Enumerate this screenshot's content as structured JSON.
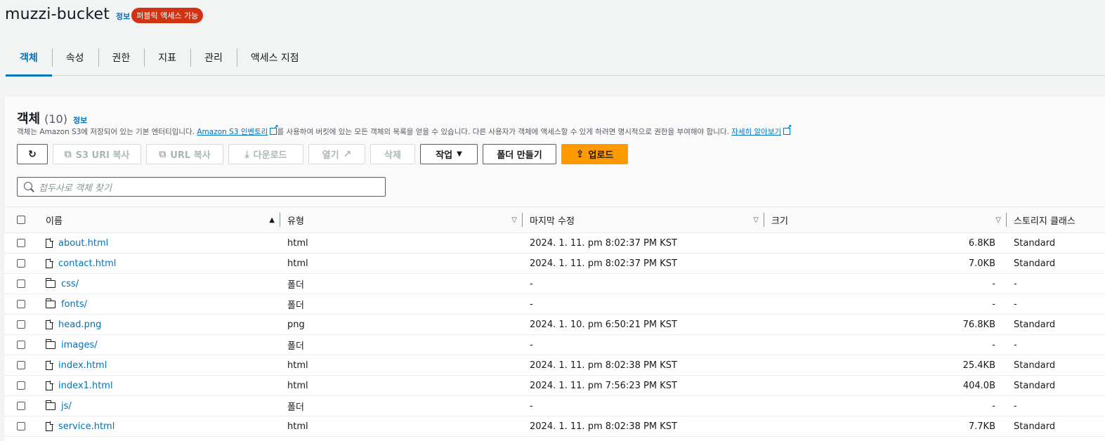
{
  "header": {
    "bucket_name": "muzzi-bucket",
    "info": "정보",
    "badge": "퍼블릭 액세스 가능"
  },
  "tabs": [
    {
      "label": "객체",
      "active": true
    },
    {
      "label": "속성"
    },
    {
      "label": "권한"
    },
    {
      "label": "지표"
    },
    {
      "label": "관리"
    },
    {
      "label": "액세스 지점"
    }
  ],
  "objects": {
    "title": "객체",
    "count": "(10)",
    "info": "정보",
    "desc_1": "객체는 Amazon S3에 저장되어 있는 기본 엔터티입니다.",
    "desc_link_1": "Amazon S3 인벤토리",
    "desc_2": "를 사용하여 버킷에 있는 모든 객체의 목록을 얻을 수 있습니다. 다른 사용자가 객체에 액세스할 수 있게 하려면 명시적으로 권한을 부여해야 합니다.",
    "desc_link_2": "자세히 알아보기"
  },
  "toolbar": {
    "s3uri": "S3 URI 복사",
    "url": "URL 복사",
    "download": "다운로드",
    "open": "열기",
    "delete": "삭제",
    "actions": "작업",
    "create_folder": "폴더 만들기",
    "upload": "업로드"
  },
  "search": {
    "placeholder": "접두사로 객체 찾기"
  },
  "columns": {
    "name": "이름",
    "type": "유형",
    "modified": "마지막 수정",
    "size": "크기",
    "storage": "스토리지 클래스"
  },
  "rows": [
    {
      "name": "about.html",
      "kind": "file",
      "type": "html",
      "modified": "2024. 1. 11. pm 8:02:37 PM KST",
      "size": "6.8KB",
      "storage": "Standard"
    },
    {
      "name": "contact.html",
      "kind": "file",
      "type": "html",
      "modified": "2024. 1. 11. pm 8:02:37 PM KST",
      "size": "7.0KB",
      "storage": "Standard"
    },
    {
      "name": "css/",
      "kind": "folder",
      "type": "폴더",
      "modified": "-",
      "size": "-",
      "storage": "-"
    },
    {
      "name": "fonts/",
      "kind": "folder",
      "type": "폴더",
      "modified": "-",
      "size": "-",
      "storage": "-"
    },
    {
      "name": "head.png",
      "kind": "file",
      "type": "png",
      "modified": "2024. 1. 10. pm 6:50:21 PM KST",
      "size": "76.8KB",
      "storage": "Standard"
    },
    {
      "name": "images/",
      "kind": "folder",
      "type": "폴더",
      "modified": "-",
      "size": "-",
      "storage": "-"
    },
    {
      "name": "index.html",
      "kind": "file",
      "type": "html",
      "modified": "2024. 1. 11. pm 8:02:38 PM KST",
      "size": "25.4KB",
      "storage": "Standard"
    },
    {
      "name": "index1.html",
      "kind": "file",
      "type": "html",
      "modified": "2024. 1. 11. pm 7:56:23 PM KST",
      "size": "404.0B",
      "storage": "Standard"
    },
    {
      "name": "js/",
      "kind": "folder",
      "type": "폴더",
      "modified": "-",
      "size": "-",
      "storage": "-"
    },
    {
      "name": "service.html",
      "kind": "file",
      "type": "html",
      "modified": "2024. 1. 11. pm 8:02:38 PM KST",
      "size": "7.7KB",
      "storage": "Standard"
    }
  ]
}
